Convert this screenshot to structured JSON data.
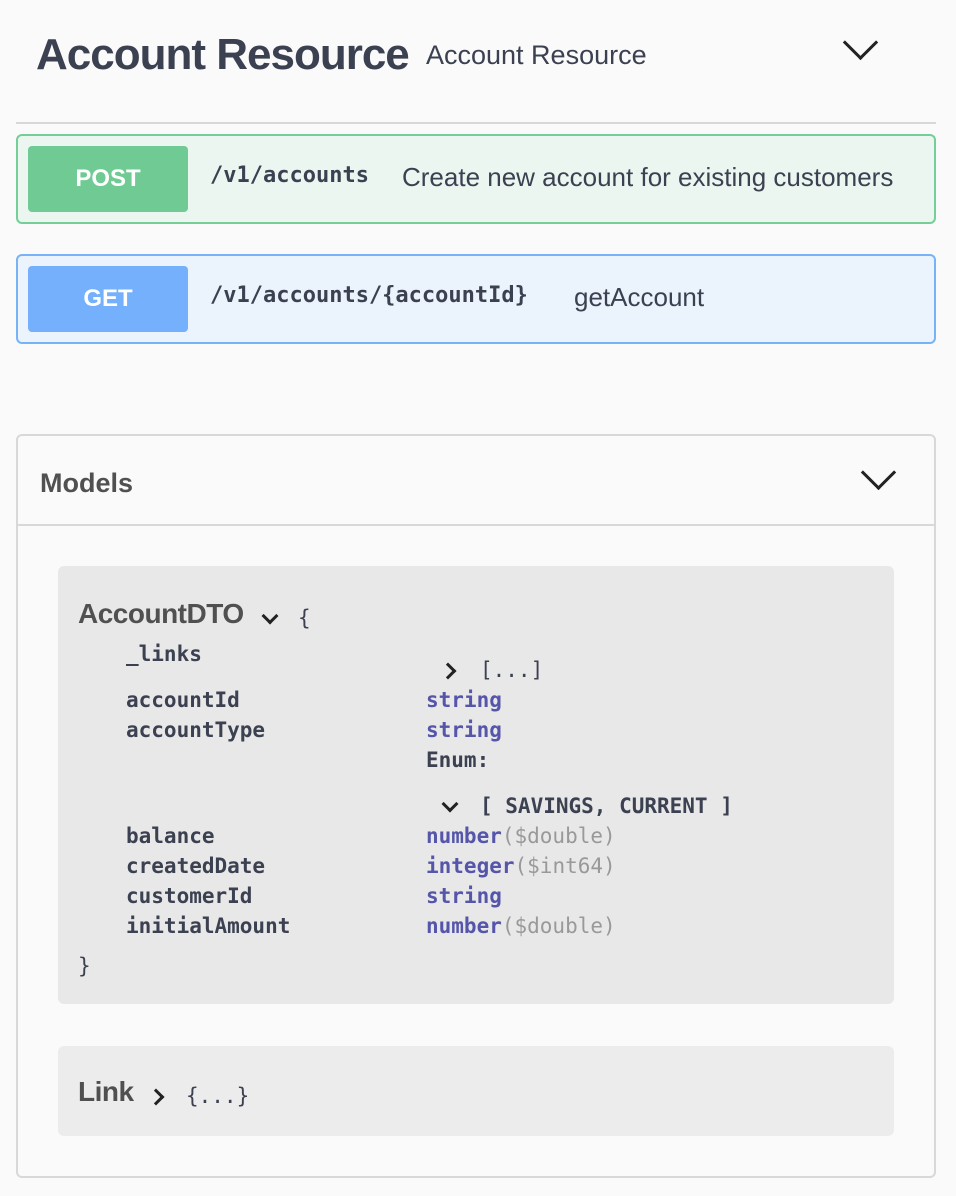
{
  "tag": {
    "title": "Account Resource",
    "description": "Account Resource"
  },
  "operations": [
    {
      "method": "POST",
      "path": "/v1/accounts",
      "summary": "Create new account for existing customers",
      "color": "#49cc90"
    },
    {
      "method": "GET",
      "path": "/v1/accounts/{accountId}",
      "summary": "getAccount",
      "color": "#61affe"
    }
  ],
  "models": {
    "title": "Models",
    "account_dto": {
      "name": "AccountDTO",
      "open_brace": "{",
      "close_brace": "}",
      "properties": [
        {
          "name": "_links",
          "value": "[...]"
        },
        {
          "name": "accountId",
          "type": "string"
        },
        {
          "name": "accountType",
          "type": "string",
          "enum_label": "Enum:",
          "enum_values": "[ SAVINGS, CURRENT ]"
        },
        {
          "name": "balance",
          "type": "number",
          "format": "($double)"
        },
        {
          "name": "createdDate",
          "type": "integer",
          "format": "($int64)"
        },
        {
          "name": "customerId",
          "type": "string"
        },
        {
          "name": "initialAmount",
          "type": "number",
          "format": "($double)"
        }
      ]
    },
    "link": {
      "name": "Link",
      "collapsed": "{...}"
    }
  }
}
